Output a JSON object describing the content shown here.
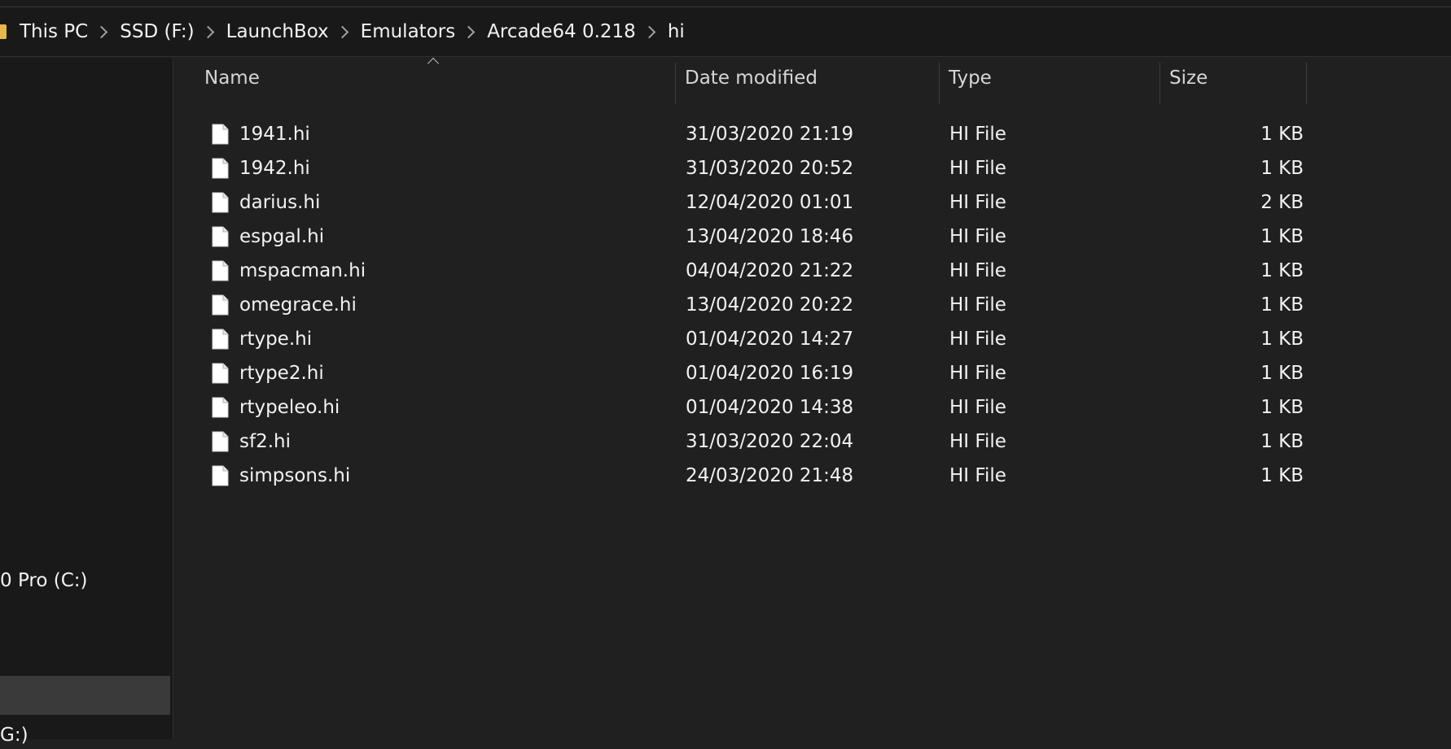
{
  "breadcrumb": {
    "items": [
      "This PC",
      "SSD (F:)",
      "LaunchBox",
      "Emulators",
      "Arcade64 0.218",
      "hi"
    ]
  },
  "nav": {
    "drive_c_label": "0 Pro (C:)",
    "drive_g_label": "G:)"
  },
  "columns": {
    "name": "Name",
    "date": "Date modified",
    "type": "Type",
    "size": "Size"
  },
  "files": [
    {
      "name": "1941.hi",
      "date": "31/03/2020 21:19",
      "type": "HI File",
      "size": "1 KB"
    },
    {
      "name": "1942.hi",
      "date": "31/03/2020 20:52",
      "type": "HI File",
      "size": "1 KB"
    },
    {
      "name": "darius.hi",
      "date": "12/04/2020 01:01",
      "type": "HI File",
      "size": "2 KB"
    },
    {
      "name": "espgal.hi",
      "date": "13/04/2020 18:46",
      "type": "HI File",
      "size": "1 KB"
    },
    {
      "name": "mspacman.hi",
      "date": "04/04/2020 21:22",
      "type": "HI File",
      "size": "1 KB"
    },
    {
      "name": "omegrace.hi",
      "date": "13/04/2020 20:22",
      "type": "HI File",
      "size": "1 KB"
    },
    {
      "name": "rtype.hi",
      "date": "01/04/2020 14:27",
      "type": "HI File",
      "size": "1 KB"
    },
    {
      "name": "rtype2.hi",
      "date": "01/04/2020 16:19",
      "type": "HI File",
      "size": "1 KB"
    },
    {
      "name": "rtypeleo.hi",
      "date": "01/04/2020 14:38",
      "type": "HI File",
      "size": "1 KB"
    },
    {
      "name": "sf2.hi",
      "date": "31/03/2020 22:04",
      "type": "HI File",
      "size": "1 KB"
    },
    {
      "name": "simpsons.hi",
      "date": "24/03/2020 21:48",
      "type": "HI File",
      "size": "1 KB"
    }
  ],
  "colors": {
    "background": "#202020",
    "nav_background": "#191919",
    "text": "#f2f2f2",
    "folder_icon": "#e8b84a",
    "selection": "#3a3a3a"
  },
  "icons": {
    "folder": "folder-icon",
    "file": "file-icon",
    "breadcrumb_separator": "chevron-right-icon",
    "sort": "sort-ascending-icon"
  }
}
